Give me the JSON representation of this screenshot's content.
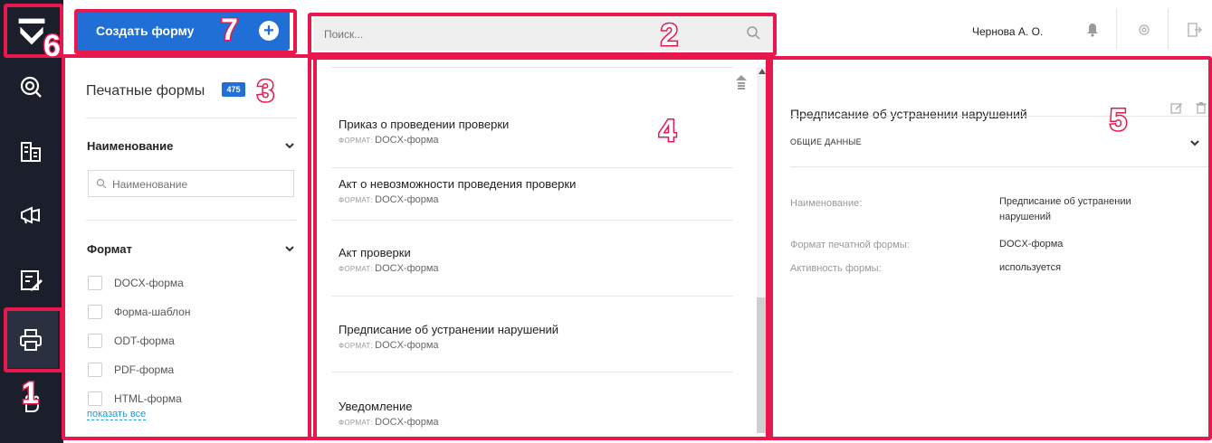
{
  "topbar": {
    "create_button_label": "Создать форму",
    "search_placeholder": "Поиск...",
    "user_name": "Чернова А. О."
  },
  "rail": {
    "icons": [
      "logo-icon",
      "search-target-icon",
      "building-icon",
      "megaphone-icon",
      "edit-list-icon",
      "printer-icon",
      "hand-icon"
    ],
    "active": "printer-icon"
  },
  "filters": {
    "title": "Печатные формы",
    "count": "475",
    "name_section": {
      "title": "Наименование",
      "placeholder": "Наименование"
    },
    "format_section": {
      "title": "Формат",
      "options": [
        "DOCX-форма",
        "Форма-шаблон",
        "ODT-форма",
        "PDF-форма",
        "HTML-форма"
      ],
      "show_all": "показать все"
    }
  },
  "list": {
    "format_label": "ФОРМАТ:",
    "items": [
      {
        "title": "Приказ о проведении проверки",
        "format": "DOCX-форма"
      },
      {
        "title": "Акт о невозможности проведения проверки",
        "format": "DOCX-форма"
      },
      {
        "title": "Акт проверки",
        "format": "DOCX-форма"
      },
      {
        "title": "Предписание об устранении нарушений",
        "format": "DOCX-форма"
      },
      {
        "title": "Уведомление",
        "format": "DOCX-форма"
      }
    ]
  },
  "detail": {
    "title": "Предписание об устранении нарушений",
    "section_label": "ОБЩИЕ ДАННЫЕ",
    "fields": [
      {
        "label": "Наименование:",
        "value": "Предписание об устранении нарушений"
      },
      {
        "label": "Формат печатной формы:",
        "value": "DOCX-форма"
      },
      {
        "label": "Активность формы:",
        "value": "используется"
      }
    ]
  },
  "annotations": {
    "numbers": [
      "1",
      "2",
      "3",
      "4",
      "5",
      "6",
      "7"
    ],
    "color": "#e8174d"
  },
  "colors": {
    "accent": "#1f6fd6",
    "rail": "#1b1f2b",
    "annotation": "#e8174d"
  }
}
